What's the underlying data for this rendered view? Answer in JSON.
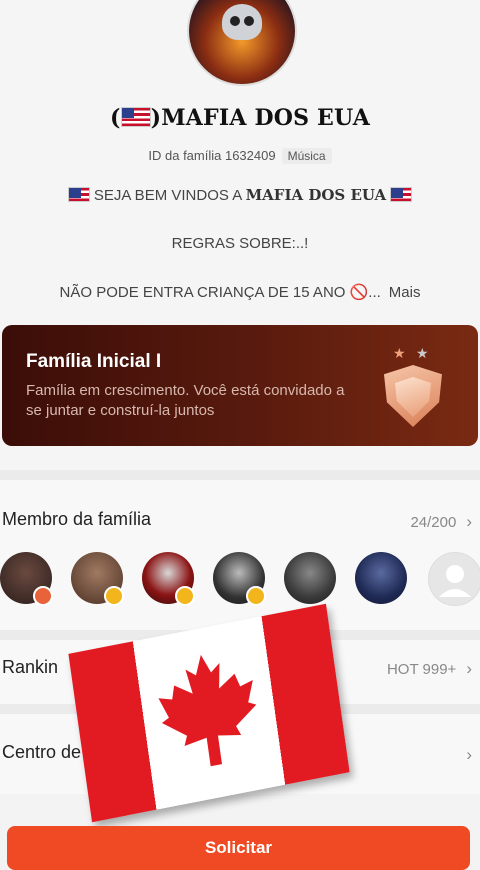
{
  "header": {
    "family_name": "MAFIA DOS EUA",
    "name_prefix": "(",
    "name_suffix": ")",
    "id_label": "ID da família 1632409",
    "category_tag": "Música"
  },
  "description": {
    "line1_prefix": "SEJA BEM VINDOS A",
    "line1_name": "MAFIA DOS EUA",
    "line2": "REGRAS SOBRE:..!",
    "line3": "NÃO PODE ENTRA  CRIANÇA DE 15 ANO 🚫...",
    "more_label": "Mais"
  },
  "banner": {
    "title": "Família Inicial I",
    "subtitle": "Família em crescimento. Você está convidado a se juntar e construí-la juntos"
  },
  "members": {
    "title": "Membro da família",
    "count": "24/200",
    "avatars": [
      {
        "name": "member-1",
        "color": "#3a2a28",
        "badge": "#e8623a"
      },
      {
        "name": "member-2",
        "color": "#6b4a3e",
        "badge": "#f2b51c"
      },
      {
        "name": "member-3",
        "color": "#9b1a1a",
        "badge": "#f2b51c"
      },
      {
        "name": "member-4",
        "color": "#2a2a2a",
        "badge": "#f2b51c"
      },
      {
        "name": "member-5",
        "color": "#4a4a4a",
        "badge": ""
      },
      {
        "name": "member-6",
        "color": "#1f2a55",
        "badge": ""
      }
    ]
  },
  "ranking": {
    "title": "Rankin",
    "value": "HOT 999+"
  },
  "center": {
    "title": "Centro de"
  },
  "footer": {
    "request_label": "Solicitar"
  }
}
